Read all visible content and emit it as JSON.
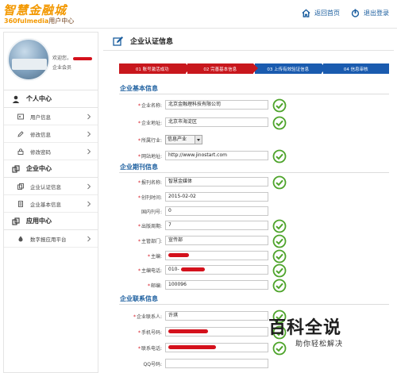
{
  "header": {
    "logo_main": "智慧金融城",
    "logo_sub_brand": "360fulmedia",
    "logo_sub_text": "用户中心",
    "links": [
      {
        "icon": "home-icon",
        "label": "返回首页"
      },
      {
        "icon": "power-icon",
        "label": "退出登录"
      }
    ]
  },
  "sidebar": {
    "welcome_prefix": "欢迎您，",
    "role": "企业会员",
    "sections": [
      {
        "icon": "user-icon",
        "label": "个人中心",
        "items": [
          {
            "icon": "id-card-icon",
            "label": "用户信息"
          },
          {
            "icon": "pencil-icon",
            "label": "修改信息"
          },
          {
            "icon": "lock-icon",
            "label": "修改密码"
          }
        ]
      },
      {
        "icon": "building-icon",
        "label": "企业中心",
        "items": [
          {
            "icon": "certificate-icon",
            "label": "企业认证信息"
          },
          {
            "icon": "document-icon",
            "label": "企业基本信息"
          }
        ]
      },
      {
        "icon": "app-icon",
        "label": "应用中心",
        "items": [
          {
            "icon": "drop-icon",
            "label": "数字报应用平台"
          }
        ]
      }
    ]
  },
  "main": {
    "title": "企业认证信息",
    "steps": [
      {
        "label": "01 账号激活成功",
        "state": "done"
      },
      {
        "label": "02 完善基本信息",
        "state": "done"
      },
      {
        "label": "03 上传有效验证信息",
        "state": "todo"
      },
      {
        "label": "04 信息审核",
        "state": "todo"
      }
    ],
    "sections": {
      "basic": "企业基本信息",
      "periodical": "企业期刊信息",
      "contact": "企业联系信息"
    },
    "basic_fields": [
      {
        "label": "企业名称:",
        "required": true,
        "value": "北京金融理科技有限公司"
      },
      {
        "label": "企业地址:",
        "required": true,
        "value": "北京市海淀区"
      },
      {
        "label": "所属行业:",
        "required": true,
        "value": "信息产业"
      },
      {
        "label": "网站地址:",
        "required": true,
        "value": "http://www.jinostart.com"
      }
    ],
    "periodical_fields": [
      {
        "label": "报刊名称:",
        "required": true,
        "value": "智慧金媒体"
      },
      {
        "label": "创刊时间:",
        "required": true,
        "value": "2015-02-02"
      },
      {
        "label": "国内刊号:",
        "required": false,
        "value": "0"
      },
      {
        "label": "出版周期:",
        "required": true,
        "value": "7"
      },
      {
        "label": "主管部门:",
        "required": true,
        "value": "宣传部"
      },
      {
        "label": "主编:",
        "required": true,
        "value": ""
      },
      {
        "label": "主编电话:",
        "required": true,
        "value": "010-"
      },
      {
        "label": "邮编:",
        "required": true,
        "value": "100096"
      }
    ],
    "contact_fields": [
      {
        "label": "企业联系人:",
        "required": true,
        "value": "许琪"
      },
      {
        "label": "手机号码:",
        "required": true,
        "value": ""
      },
      {
        "label": "联系电话:",
        "required": true,
        "value": ""
      },
      {
        "label": "QQ号码:",
        "required": false,
        "value": ""
      }
    ]
  },
  "watermark": {
    "title": "百科全说",
    "subtitle": "助你轻松解决"
  },
  "colors": {
    "accent_orange": "#f39800",
    "step_red": "#c8171d",
    "step_blue": "#1a5baf",
    "section_blue": "#1a5d9e",
    "check_green": "#4ea42b"
  }
}
